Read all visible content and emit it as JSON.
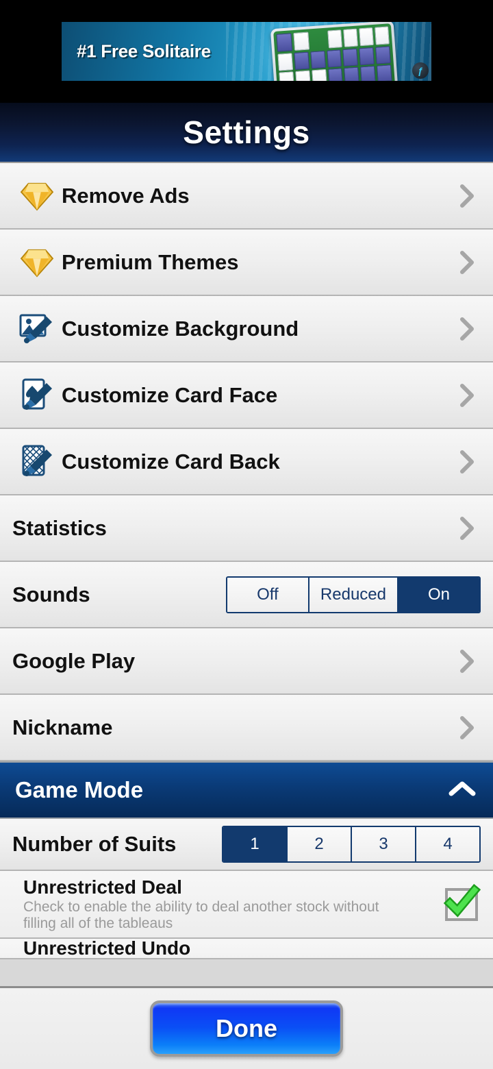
{
  "ad": {
    "headline": "#1 Free Solitaire",
    "logo_glyph": "ƒ",
    "logo_icon_name": "advertiser-logo-icon"
  },
  "header": {
    "title": "Settings"
  },
  "colors": {
    "accent_navy": "#123a6e",
    "header_blue": "#0e4b94",
    "done_blue": "#0a4ff5",
    "check_green": "#3ecf3e",
    "chevron_gray": "#a6a6a6",
    "gem_gold": "#f0b429"
  },
  "list": {
    "items": [
      {
        "label": "Remove Ads",
        "icon": "gem-icon",
        "type": "nav",
        "chevron": "chevron-right-icon"
      },
      {
        "label": "Premium Themes",
        "icon": "gem-icon",
        "type": "nav",
        "chevron": "chevron-right-icon"
      },
      {
        "label": "Customize Background",
        "icon": "picture-brush-icon",
        "type": "nav",
        "chevron": "chevron-right-icon"
      },
      {
        "label": "Customize Card Face",
        "icon": "card-face-brush-icon",
        "type": "nav",
        "chevron": "chevron-right-icon"
      },
      {
        "label": "Customize Card Back",
        "icon": "card-back-brush-icon",
        "type": "nav",
        "chevron": "chevron-right-icon"
      },
      {
        "label": "Statistics",
        "icon": null,
        "type": "nav",
        "chevron": "chevron-right-icon"
      }
    ],
    "sounds": {
      "label": "Sounds",
      "options": [
        "Off",
        "Reduced",
        "On"
      ],
      "selected": "On"
    },
    "after_sounds": [
      {
        "label": "Google Play",
        "icon": null,
        "type": "nav",
        "chevron": "chevron-right-icon"
      },
      {
        "label": "Nickname",
        "icon": null,
        "type": "nav",
        "chevron": "chevron-right-icon"
      }
    ]
  },
  "game_mode": {
    "title": "Game Mode",
    "collapse_icon": "chevron-up-icon",
    "expanded": true,
    "suits": {
      "label": "Number of Suits",
      "options": [
        "1",
        "2",
        "3",
        "4"
      ],
      "selected": "1"
    },
    "unrestricted_deal": {
      "title": "Unrestricted Deal",
      "description": "Check to enable the ability to deal another stock without filling all of the tableaus",
      "checked": true,
      "check_icon": "checkmark-icon"
    },
    "unrestricted_undo": {
      "title": "Unrestricted Undo"
    }
  },
  "footer": {
    "done_label": "Done"
  }
}
